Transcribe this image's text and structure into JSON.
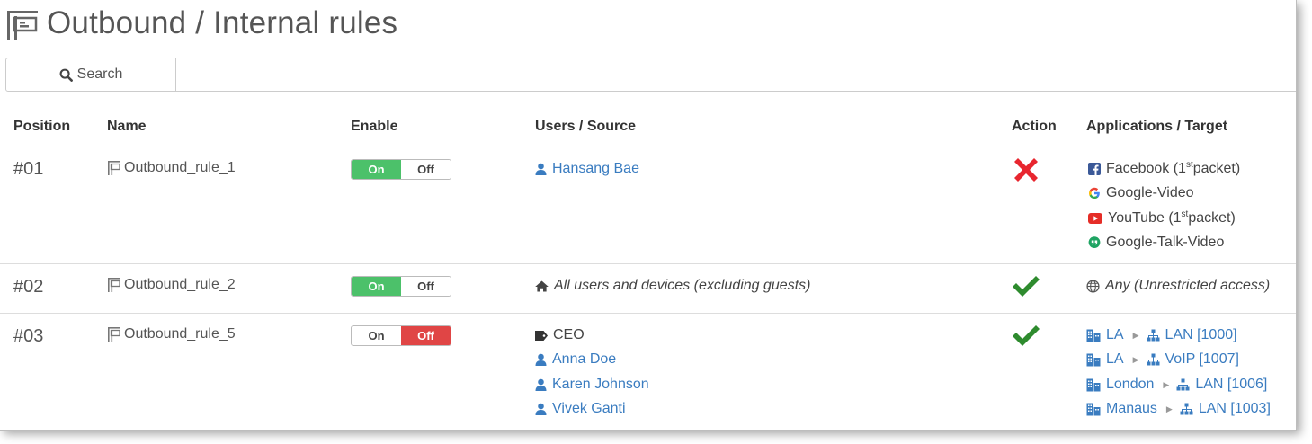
{
  "page": {
    "title": "Outbound / Internal rules"
  },
  "search": {
    "label": "Search",
    "placeholder": ""
  },
  "columns": {
    "position": "Position",
    "name": "Name",
    "enable": "Enable",
    "users_source": "Users / Source",
    "action": "Action",
    "applications_target": "Applications / Target"
  },
  "toggle": {
    "on": "On",
    "off": "Off"
  },
  "rules": [
    {
      "position": "#01",
      "name": "Outbound_rule_1",
      "enabled": true,
      "sources": [
        {
          "type": "user",
          "label": "Hansang Bae"
        }
      ],
      "action": "deny",
      "apps": [
        {
          "icon": "facebook-icon",
          "label": "Facebook (1",
          "sup": "st",
          "suffix": " packet)"
        },
        {
          "icon": "google-icon",
          "label": "Google-Video"
        },
        {
          "icon": "youtube-icon",
          "label": "YouTube (1",
          "sup": "st",
          "suffix": " packet)"
        },
        {
          "icon": "hangouts-icon",
          "label": "Google-Talk-Video"
        }
      ]
    },
    {
      "position": "#02",
      "name": "Outbound_rule_2",
      "enabled": true,
      "sources": [
        {
          "type": "home",
          "label": "All users and devices (excluding guests)"
        }
      ],
      "action": "allow",
      "apps": [
        {
          "icon": "globe-icon",
          "label": "Any (Unrestricted access)"
        }
      ]
    },
    {
      "position": "#03",
      "name": "Outbound_rule_5",
      "enabled": false,
      "sources": [
        {
          "type": "tag",
          "label": "CEO"
        },
        {
          "type": "user",
          "label": "Anna Doe"
        },
        {
          "type": "user",
          "label": "Karen Johnson"
        },
        {
          "type": "user",
          "label": "Vivek Ganti"
        }
      ],
      "action": "allow",
      "targets": [
        {
          "site": "LA",
          "network": "LAN [1000]"
        },
        {
          "site": "LA",
          "network": "VoIP [1007]"
        },
        {
          "site": "London",
          "network": "LAN [1006]"
        },
        {
          "site": "Manaus",
          "network": "LAN [1003]"
        }
      ]
    }
  ],
  "colors": {
    "link": "#3a7cc0",
    "toggle_on": "#4cc16a",
    "toggle_off": "#e04545",
    "deny": "#e8262f",
    "allow": "#2e8b2e"
  }
}
